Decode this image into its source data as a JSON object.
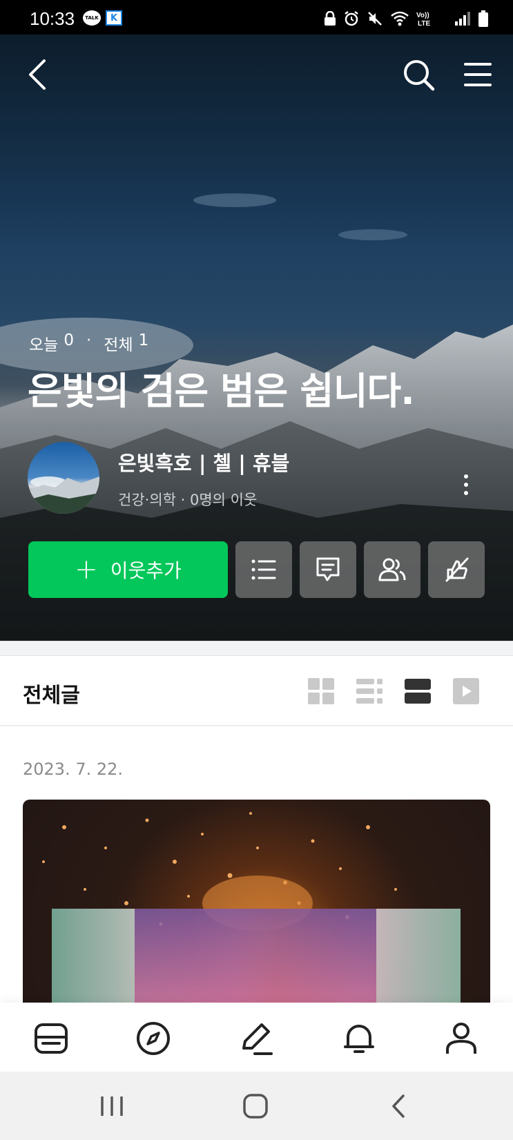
{
  "status_bar": {
    "time": "10:33",
    "notification_icons": [
      "kakaotalk-icon",
      "k-app-icon"
    ],
    "system_icons": [
      "lock-icon",
      "alarm-icon",
      "mute-icon",
      "wifi-icon",
      "volte-icon",
      "signal-icon",
      "battery-icon"
    ],
    "talk_label": "TALK",
    "k_label": "K"
  },
  "header": {
    "back_icon": "chevron-left-icon",
    "search_icon": "search-icon",
    "menu_icon": "hamburger-menu-icon"
  },
  "blog": {
    "today_label": "오늘",
    "today_count": "0",
    "separator": "·",
    "total_label": "전체",
    "total_count": "1",
    "title": "은빛의 검은 범은 쉽니다.",
    "nickname": "은빛흑호 | 첼 | 휴블",
    "category": "건강·의학 · 0명의 이웃"
  },
  "actions": {
    "add_neighbor_label": "이웃추가",
    "buttons": [
      "list-icon",
      "comment-icon",
      "neighbors-icon",
      "sympathy-off-icon"
    ]
  },
  "post_list": {
    "title": "전체글",
    "view_modes": [
      "grid-view-icon",
      "list-grid-view-icon",
      "card-view-icon",
      "video-view-icon"
    ],
    "selected_view": "card-view-icon"
  },
  "posts": [
    {
      "date": "2023. 7. 22."
    }
  ],
  "tabbar": {
    "items": [
      "feed-icon",
      "discover-compass-icon",
      "write-pencil-icon",
      "notification-bell-icon",
      "profile-icon"
    ]
  },
  "navbar": {
    "items": [
      "recent-apps-icon",
      "home-icon",
      "back-icon"
    ]
  },
  "colors": {
    "accent_green": "#03c75a",
    "status_bar": "#000000",
    "nav_bar": "#f1f1f1"
  }
}
